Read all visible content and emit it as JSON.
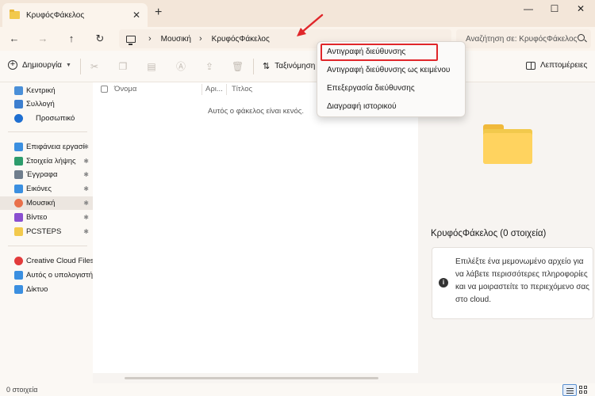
{
  "window": {
    "tab_title": "ΚρυφόςΦάκελος",
    "tab_close": "✕",
    "new_tab": "+",
    "minimize": "—",
    "maximize": "☐",
    "close": "✕"
  },
  "nav": {
    "back_icon": "←",
    "forward_icon": "→",
    "up_icon": "↑",
    "refresh_icon": "↻",
    "chevron": "›",
    "breadcrumb": [
      "Μουσική",
      "ΚρυφόςΦάκελος"
    ],
    "search_placeholder": "Αναζήτηση σε: ΚρυφόςΦάκελος"
  },
  "toolbar": {
    "create_label": "Δημιουργία",
    "sort_label": "Ταξινόμηση",
    "details_label": "Λεπτομέρειες"
  },
  "sidebar": {
    "items": [
      {
        "label": "Κεντρική",
        "icon": "home-icon",
        "color": "#4a8fd8"
      },
      {
        "label": "Συλλογή",
        "icon": "gallery-icon",
        "color": "#3d7fcf"
      },
      {
        "label": "Προσωπικό",
        "icon": "onedrive-icon",
        "color": "#1f6fd1"
      },
      {
        "label": "Επιφάνεια εργασί",
        "icon": "desktop-icon",
        "color": "#3b8fe0"
      },
      {
        "label": "Στοιχεία λήψης",
        "icon": "download-icon",
        "color": "#2d9c6c"
      },
      {
        "label": "Έγγραφα",
        "icon": "documents-icon",
        "color": "#6f7d8c"
      },
      {
        "label": "Εικόνες",
        "icon": "pictures-icon",
        "color": "#3b8fe0"
      },
      {
        "label": "Μουσική",
        "icon": "music-icon",
        "color": "#e9704a"
      },
      {
        "label": "Βίντεο",
        "icon": "videos-icon",
        "color": "#8a4fd0"
      },
      {
        "label": "PCSTEPS",
        "icon": "folder-icon",
        "color": "#f2c94c"
      },
      {
        "label": "Creative Cloud Files P",
        "icon": "creative-cloud-icon",
        "color": "#e23b3b"
      },
      {
        "label": "Αυτός ο υπολογιστή",
        "icon": "this-pc-icon",
        "color": "#3b8fe0"
      },
      {
        "label": "Δίκτυο",
        "icon": "network-icon",
        "color": "#3b8fe0"
      }
    ],
    "pin_glyph": "📌"
  },
  "columns": [
    "Όνομα",
    "Αρι...",
    "Τίτλος"
  ],
  "empty_message": "Αυτός ο φάκελος είναι κενός.",
  "details_pane": {
    "title": "ΚρυφόςΦάκελος (0 στοιχεία)",
    "info_text": "Επιλέξτε ένα μεμονωμένο αρχείο για να λάβετε περισσότερες πληροφορίες και να μοιραστείτε το περιεχόμενο σας στο cloud."
  },
  "status": {
    "count": "0 στοιχεία"
  },
  "context_menu": {
    "items": [
      "Αντιγραφή διεύθυνσης",
      "Αντιγραφή διεύθυνσης ως κειμένου",
      "Επεξεργασία διεύθυνσης",
      "Διαγραφή ιστορικού"
    ]
  },
  "colors": {
    "accent": "#1f6fd1",
    "annotation": "#e0262a",
    "folder": "#f2c94c"
  }
}
